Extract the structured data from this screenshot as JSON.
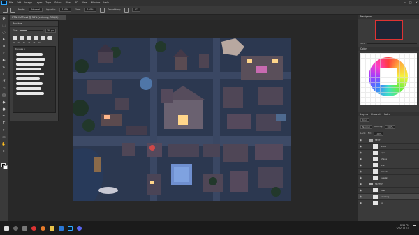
{
  "menubar": {
    "items": [
      "File",
      "Edit",
      "Image",
      "Layer",
      "Type",
      "Select",
      "Filter",
      "3D",
      "View",
      "Window",
      "Help"
    ],
    "window_controls": [
      "–",
      "□",
      "✕"
    ]
  },
  "options_bar": {
    "mode_label": "Mode:",
    "mode_value": "Normal",
    "opacity_label": "Opacity:",
    "opacity_value": "100%",
    "flow_label": "Flow:",
    "flow_value": "100%",
    "smoothing_label": "Smoothing:",
    "angle_value": "0°"
  },
  "document": {
    "tab_title": "XTAL MAP.psd @ 33% (coloring, RGB/8)"
  },
  "brush_panel": {
    "title": "Brushes",
    "size_label": "Size:",
    "size_value": "30 px",
    "size_fraction": 0.3,
    "tip_sizes": [
      "30",
      "30",
      "30",
      "25",
      "25",
      "25"
    ],
    "group_label": "Brushes 1"
  },
  "navigator": {
    "title": "Navigator",
    "zoom_value": "33%"
  },
  "color_panel": {
    "title": "Color"
  },
  "layers_panel": {
    "tabs": [
      "Layers",
      "Channels",
      "Paths"
    ],
    "kind_label": "Kind",
    "blend_mode": "Normal",
    "opacity_label": "Opacity:",
    "opacity_value": "100%",
    "lock_label": "Lock:",
    "fill_label": "Fill:",
    "fill_value": "100%",
    "layers": [
      {
        "name": "TEXT",
        "type": "group"
      },
      {
        "name": "water",
        "type": "layer"
      },
      {
        "name": "sign",
        "type": "layer"
      },
      {
        "name": "shade",
        "type": "layer"
      },
      {
        "name": "line",
        "type": "layer"
      },
      {
        "name": "lineart",
        "type": "layer"
      },
      {
        "name": "overlay",
        "type": "layer"
      },
      {
        "name": "SKETCH",
        "type": "group"
      },
      {
        "name": "base",
        "type": "layer"
      },
      {
        "name": "coloring",
        "type": "layer",
        "selected": true
      },
      {
        "name": "bg",
        "type": "layer"
      }
    ]
  },
  "taskbar": {
    "time": "2:55 PM",
    "date": "2020-01-15",
    "apps": [
      "start-icon",
      "search-icon",
      "taskview-icon",
      "chrome-icon",
      "firefox-icon",
      "explorer-icon",
      "store-icon",
      "photoshop-icon",
      "discord-icon"
    ]
  }
}
